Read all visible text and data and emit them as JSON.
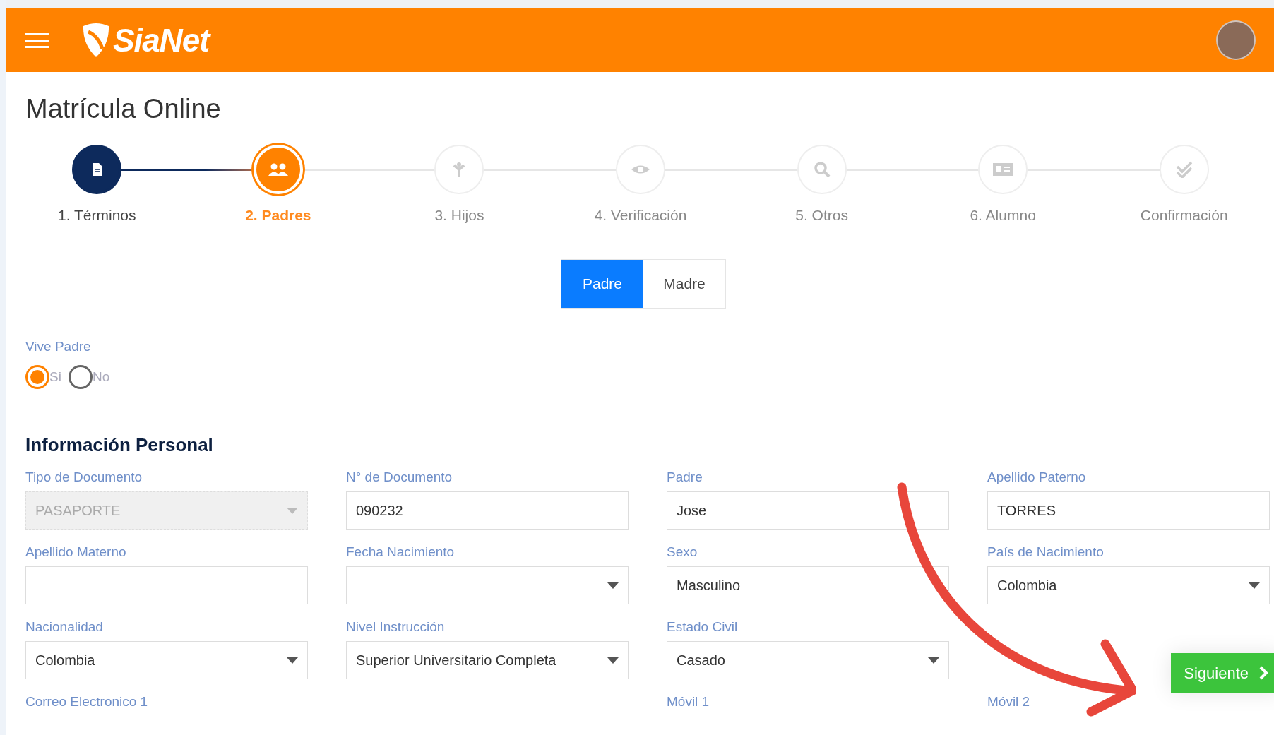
{
  "header": {
    "logo": "SiaNet"
  },
  "page_title": "Matrícula Online",
  "steps": [
    {
      "label": "1. Términos",
      "completed": true,
      "selected": false
    },
    {
      "label": "2. Padres",
      "completed": false,
      "selected": true
    },
    {
      "label": "3. Hijos",
      "completed": false,
      "selected": false
    },
    {
      "label": "4. Verificación",
      "completed": false,
      "selected": false
    },
    {
      "label": "5. Otros",
      "completed": false,
      "selected": false
    },
    {
      "label": "6. Alumno",
      "completed": false,
      "selected": false
    },
    {
      "label": "Confirmación",
      "completed": false,
      "selected": false
    }
  ],
  "parent_tabs": [
    {
      "label": "Padre",
      "selected": true
    },
    {
      "label": "Madre",
      "selected": false
    }
  ],
  "vive_padre": {
    "label": "Vive Padre",
    "options": [
      {
        "label": "Si",
        "selected": true
      },
      {
        "label": "No",
        "selected": false
      }
    ]
  },
  "section_title": "Información Personal",
  "fields": [
    {
      "label": "Tipo de Documento",
      "value": "PASAPORTE",
      "kind": "select",
      "disabled": true
    },
    {
      "label": "N° de Documento",
      "value": "090232",
      "kind": "text",
      "disabled": false
    },
    {
      "label": "Padre",
      "value": "Jose",
      "kind": "text",
      "disabled": false
    },
    {
      "label": "Apellido Paterno",
      "value": "TORRES",
      "kind": "text",
      "disabled": false
    },
    {
      "label": "Apellido Materno",
      "kind": "text",
      "disabled": false
    },
    {
      "label": "Fecha Nacimiento",
      "kind": "select",
      "disabled": false
    },
    {
      "label": "Sexo",
      "value": "Masculino",
      "kind": "text",
      "disabled": false
    },
    {
      "label": "País de Nacimiento",
      "value": "Colombia",
      "kind": "select",
      "disabled": false
    },
    {
      "label": "Nacionalidad",
      "value": "Colombia",
      "kind": "select",
      "disabled": false
    },
    {
      "label": "Nivel Instrucción",
      "value": "Superior Universitario Completa",
      "kind": "select",
      "disabled": false
    },
    {
      "label": "Estado Civil",
      "value": "Casado",
      "kind": "select",
      "disabled": false
    }
  ],
  "cut_off_labels": [
    "Correo Electronico 1",
    "Móvil 1",
    "Móvil 2"
  ],
  "next_button": {
    "label": "Siguiente"
  }
}
